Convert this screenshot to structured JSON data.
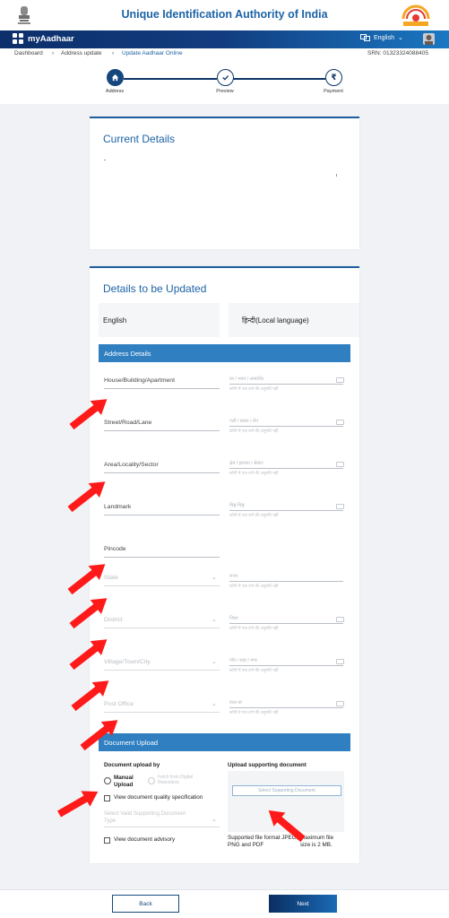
{
  "header": {
    "title": "Unique Identification Authority of India",
    "emblem_icon": "national-emblem-icon",
    "logo_icon": "aadhaar-logo-icon",
    "accent": "#1d63a6"
  },
  "navbar": {
    "brand": "myAadhaar",
    "language": "English",
    "gradient_start": "#0d2f6b",
    "gradient_end": "#1a78c2"
  },
  "breadcrumb": {
    "items": [
      "Dashboard",
      "Address update",
      "Update Aadhaar Online"
    ],
    "srn": "SRN: 01323324088405"
  },
  "stepper": {
    "steps": [
      {
        "label": "Address",
        "icon": "home-icon",
        "active": true
      },
      {
        "label": "Preview",
        "icon": "check-icon",
        "active": false
      },
      {
        "label": "Payment",
        "icon": "rupee-icon",
        "active": false
      }
    ]
  },
  "current_details": {
    "title": "Current Details"
  },
  "update": {
    "title": "Details to be Updated",
    "tab_english": "English",
    "tab_local": "हिन्दी(Local language)",
    "address_section": "Address Details",
    "local_note": "कॉपी में एक वर्ण की अनुमति नहीं",
    "fields": [
      {
        "label": "House/Building/Apartment",
        "local": "घर / भवन / अपार्टमेंट",
        "disabled": false,
        "select": false
      },
      {
        "label": "Street/Road/Lane",
        "local": "गली / सड़क / लेन",
        "disabled": false,
        "select": false
      },
      {
        "label": "Area/Locality/Sector",
        "local": "क्षेत्र / इलाका / सेक्टर",
        "disabled": false,
        "select": false
      },
      {
        "label": "Landmark",
        "local": "चिह्न चिह्न",
        "disabled": false,
        "select": false
      },
      {
        "label": "Pincode",
        "local": "",
        "disabled": false,
        "select": false
      },
      {
        "label": "State",
        "local": "राज्य",
        "disabled": true,
        "select": true
      },
      {
        "label": "District",
        "local": "जिला",
        "disabled": true,
        "select": true
      },
      {
        "label": "Village/Town/City",
        "local": "गाँव / शहर / नगर",
        "disabled": true,
        "select": true
      },
      {
        "label": "Post Office",
        "local": "डाक घर",
        "disabled": true,
        "select": true
      }
    ]
  },
  "document": {
    "section": "Document Upload",
    "upload_by": "Document upload by",
    "manual_upload": "Manual Upload",
    "digilocker": "Fetch from Digital Repository",
    "quality_spec": "View document quality specification",
    "select_doc": "Select Valid Supporting Document Type",
    "advisory": "View document advisory",
    "upload_heading": "Upload supporting document",
    "upload_button": "Select Supporting Document",
    "format_note": "Supported file format JPEG, PNG and PDF",
    "size_note": "Maximum file size is 2 MB."
  },
  "footer": {
    "back": "Back",
    "next": "Next"
  },
  "annotation_color": "#ff1a1a"
}
